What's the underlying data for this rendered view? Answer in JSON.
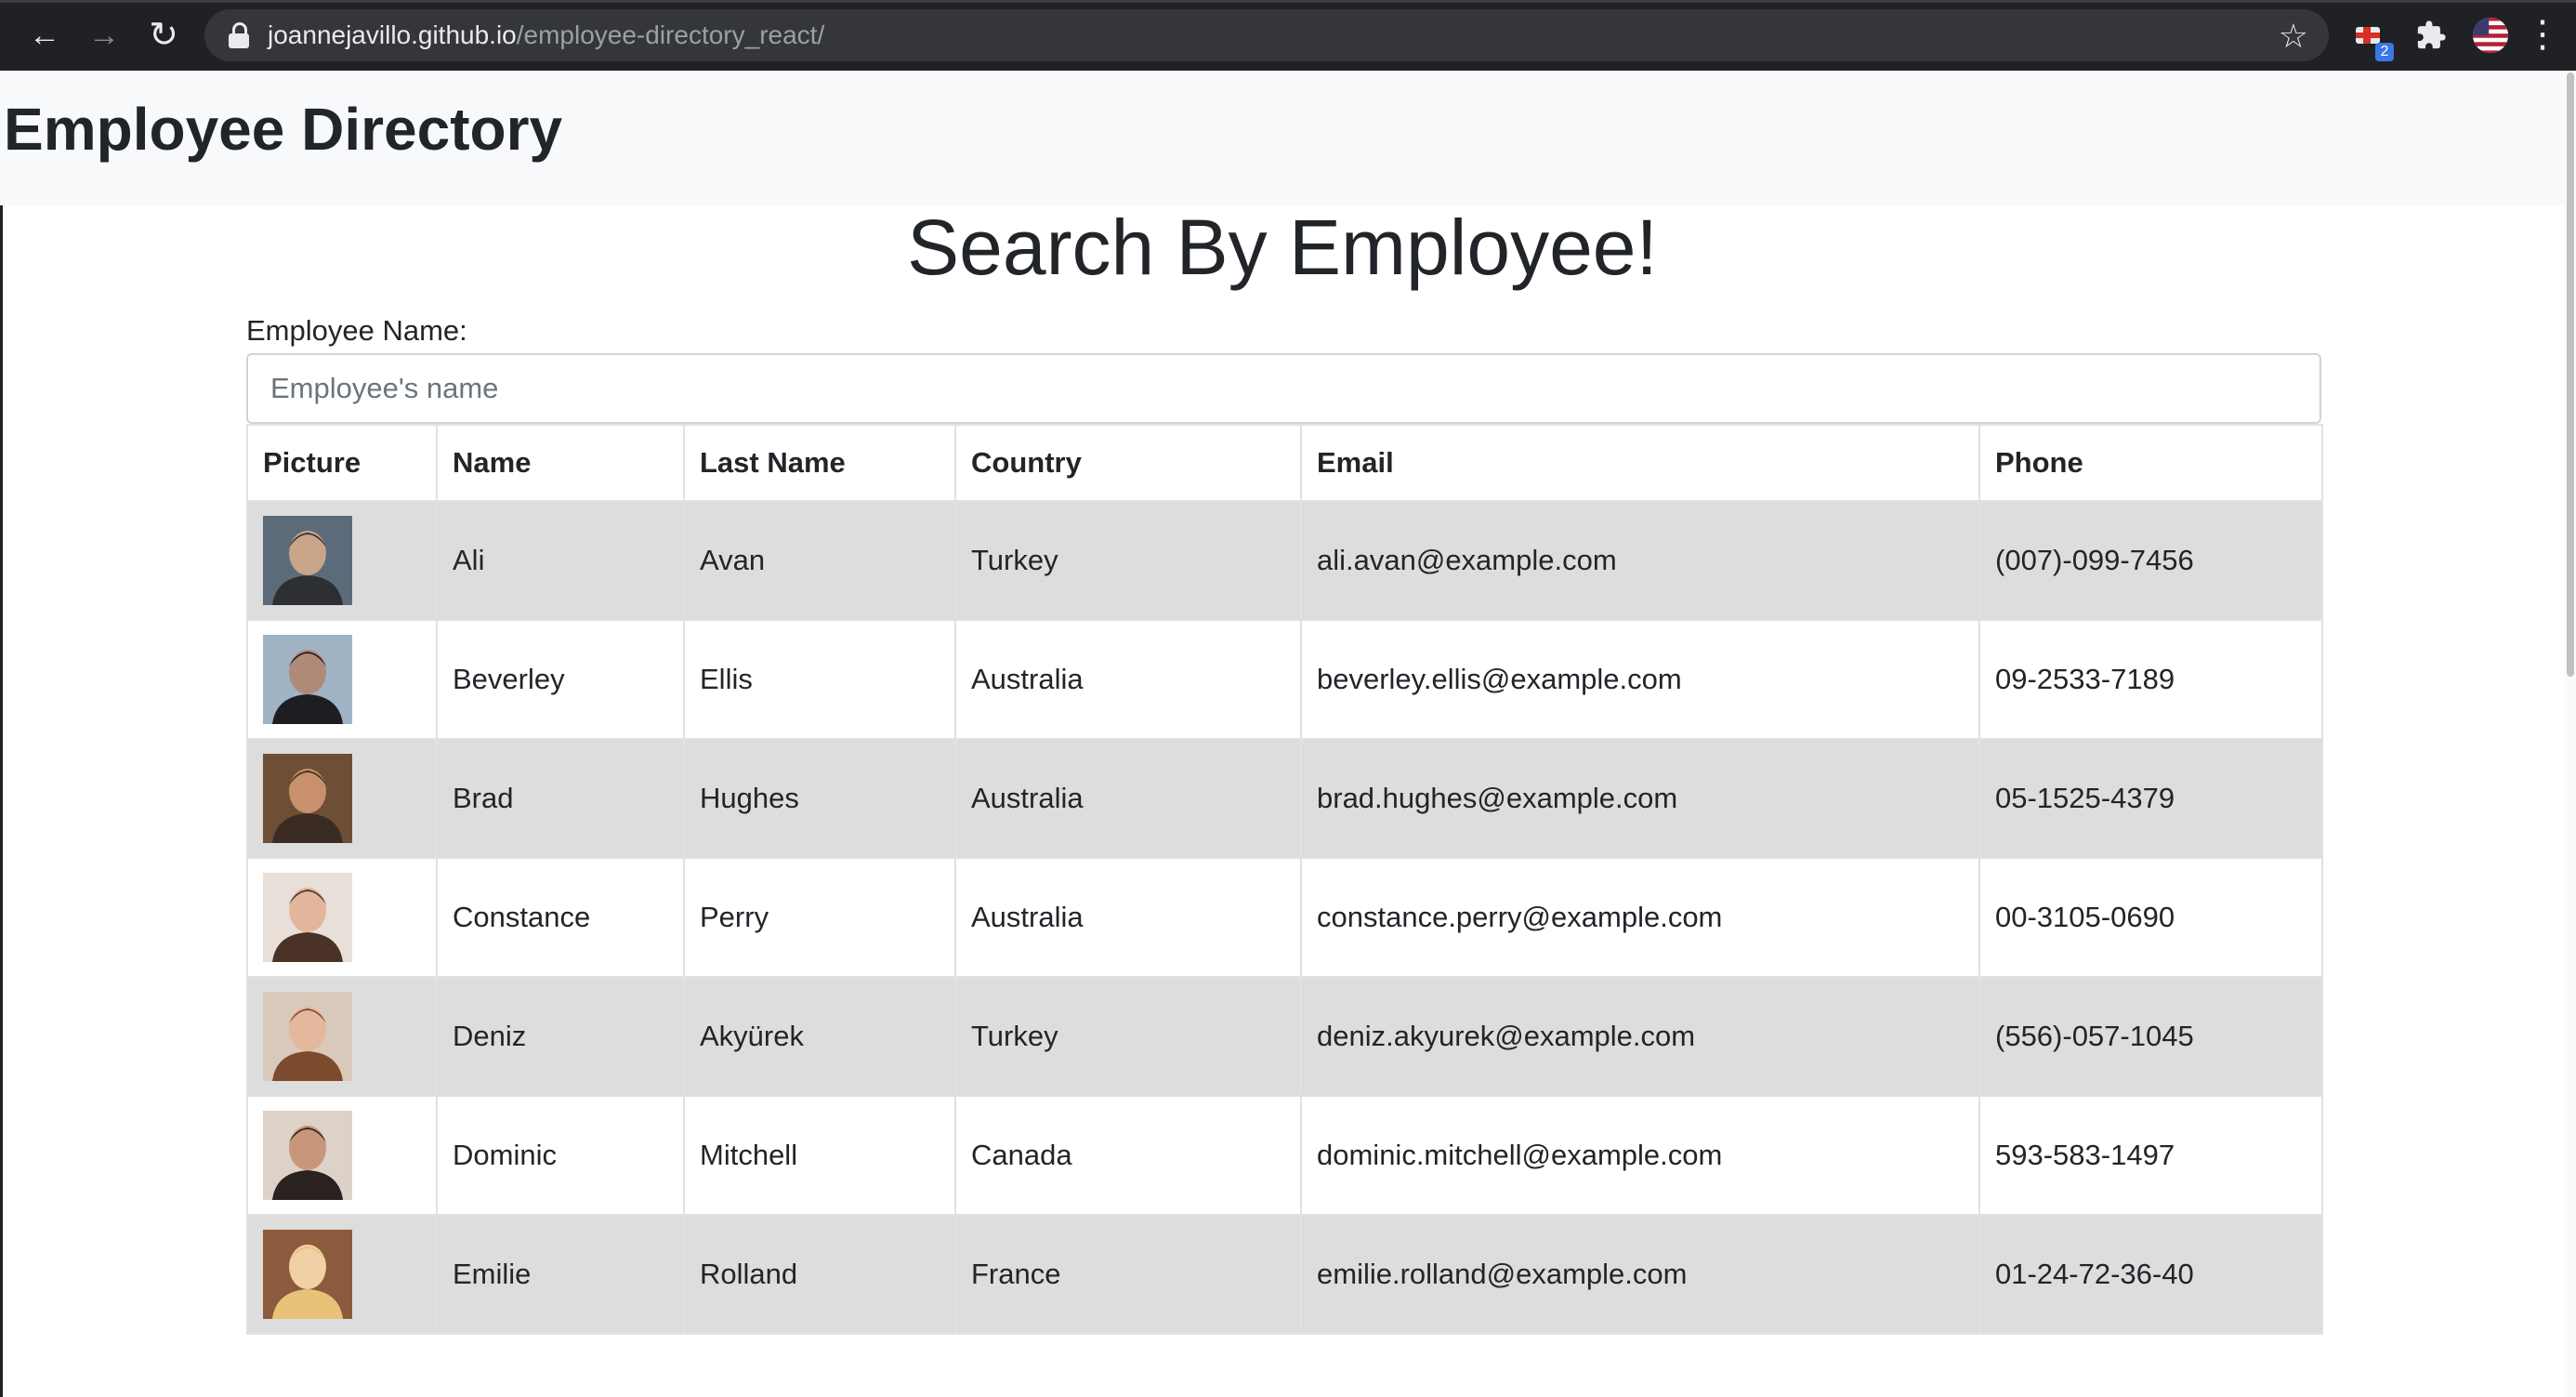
{
  "browser": {
    "url_host": "joannejavillo.github.io",
    "url_path": "/employee-directory_react/",
    "extension_badge": "2"
  },
  "header": {
    "title": "Employee Directory"
  },
  "search": {
    "heading": "Search By Employee!",
    "label": "Employee Name:",
    "placeholder": "Employee's name",
    "value": ""
  },
  "table": {
    "columns": [
      "Picture",
      "Name",
      "Last Name",
      "Country",
      "Email",
      "Phone"
    ],
    "rows": [
      {
        "first": "Ali",
        "last": "Avan",
        "country": "Turkey",
        "email": "ali.avan@example.com",
        "phone": "(007)-099-7456",
        "colors": [
          "#5b6b7a",
          "#c9a58a",
          "#2d2f33"
        ]
      },
      {
        "first": "Beverley",
        "last": "Ellis",
        "country": "Australia",
        "email": "beverley.ellis@example.com",
        "phone": "09-2533-7189",
        "colors": [
          "#9fb3c4",
          "#b08a78",
          "#1e1e22"
        ]
      },
      {
        "first": "Brad",
        "last": "Hughes",
        "country": "Australia",
        "email": "brad.hughes@example.com",
        "phone": "05-1525-4379",
        "colors": [
          "#6e4f35",
          "#c8906c",
          "#3a2c22"
        ]
      },
      {
        "first": "Constance",
        "last": "Perry",
        "country": "Australia",
        "email": "constance.perry@example.com",
        "phone": "00-3105-0690",
        "colors": [
          "#e8dfd8",
          "#e2b69c",
          "#4a3326"
        ]
      },
      {
        "first": "Deniz",
        "last": "Akyürek",
        "country": "Turkey",
        "email": "deniz.akyurek@example.com",
        "phone": "(556)-057-1045",
        "colors": [
          "#d9c9bb",
          "#e5b89d",
          "#7c4a2d"
        ]
      },
      {
        "first": "Dominic",
        "last": "Mitchell",
        "country": "Canada",
        "email": "dominic.mitchell@example.com",
        "phone": "593-583-1497",
        "colors": [
          "#ddd2c7",
          "#c8967a",
          "#2a2220"
        ]
      },
      {
        "first": "Emilie",
        "last": "Rolland",
        "country": "France",
        "email": "emilie.rolland@example.com",
        "phone": "01-24-72-36-40",
        "colors": [
          "#8c5a3c",
          "#f1d0a6",
          "#e8c279"
        ]
      }
    ]
  }
}
